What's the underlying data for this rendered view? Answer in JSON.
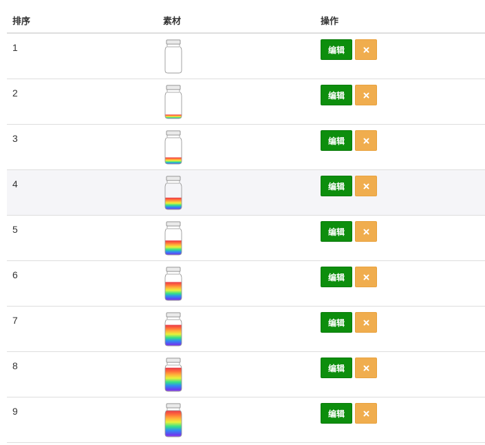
{
  "table": {
    "headers": {
      "order": "排序",
      "material": "素材",
      "actions": "操作"
    },
    "edit_label": "编辑",
    "delete_icon": "close-icon",
    "rows": [
      {
        "order": "1",
        "fill": 0.0
      },
      {
        "order": "2",
        "fill": 0.15
      },
      {
        "order": "3",
        "fill": 0.25
      },
      {
        "order": "4",
        "fill": 0.45
      },
      {
        "order": "5",
        "fill": 0.55
      },
      {
        "order": "6",
        "fill": 0.7
      },
      {
        "order": "7",
        "fill": 0.8
      },
      {
        "order": "8",
        "fill": 0.9
      },
      {
        "order": "9",
        "fill": 1.0
      }
    ],
    "highlight_row": 3
  },
  "colors": {
    "edit_button": "#0d8e0d",
    "delete_button": "#f0ad4e",
    "row_highlight": "#f5f5f8"
  }
}
